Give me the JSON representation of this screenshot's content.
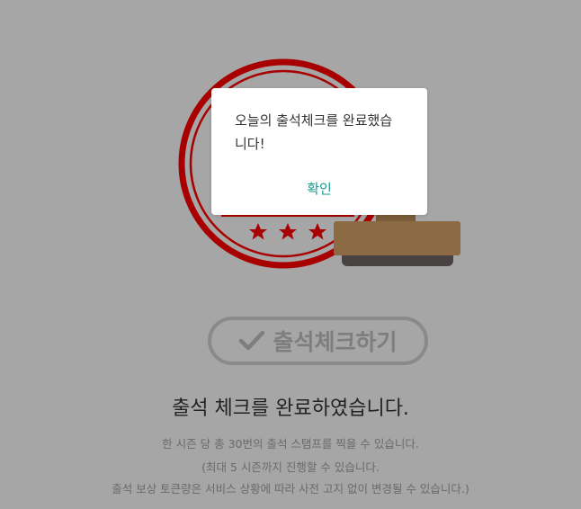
{
  "dialog": {
    "message_line1": "오늘의 출석체크를 완료했습",
    "message_line2": "니다!",
    "confirm_label": "확인"
  },
  "checkin_button": {
    "label": "출석체크하기"
  },
  "result": {
    "title": "출석 체크를 완료하였습니다."
  },
  "notes": [
    "한 시즌 당 총 30번의 출석 스탬프를 찍을 수 있습니다.",
    "(최대 5 시즌까지 진행할 수 있습니다.",
    "출석 보상 토큰량은 서비스 상황에 따라 사전 고지 없이 변경될 수 있습니다.)"
  ],
  "colors": {
    "overlay_bg": "#a6a6a6",
    "seal_red": "#a80000",
    "stamp_wood": "#8b6a44",
    "stamp_base": "#4a4242",
    "accent_teal": "#1a9a8e"
  },
  "icons": {
    "checkin": "check-icon",
    "seal": "seal-icon",
    "stamp": "stamp-icon"
  }
}
